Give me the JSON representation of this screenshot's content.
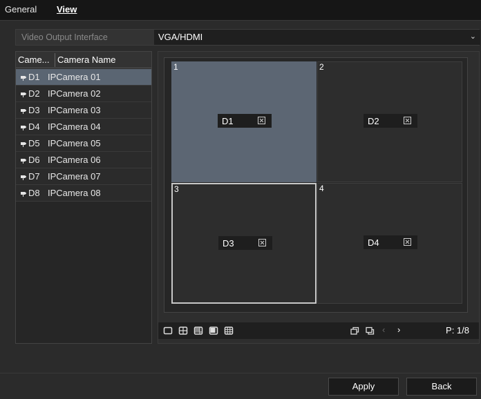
{
  "tabs": [
    {
      "label": "General",
      "active": false
    },
    {
      "label": "View",
      "active": true
    }
  ],
  "video_output": {
    "label": "Video Output Interface",
    "value": "VGA/HDMI"
  },
  "camera_list": {
    "headers": [
      "Came...",
      "Camera Name"
    ],
    "rows": [
      {
        "no": "D1",
        "name": "IPCamera 01",
        "selected": true
      },
      {
        "no": "D2",
        "name": "IPCamera 02",
        "selected": false
      },
      {
        "no": "D3",
        "name": "IPCamera 03",
        "selected": false
      },
      {
        "no": "D4",
        "name": "IPCamera 04",
        "selected": false
      },
      {
        "no": "D5",
        "name": "IPCamera 05",
        "selected": false
      },
      {
        "no": "D6",
        "name": "IPCamera 06",
        "selected": false
      },
      {
        "no": "D7",
        "name": "IPCamera 07",
        "selected": false
      },
      {
        "no": "D8",
        "name": "IPCamera 08",
        "selected": false
      }
    ]
  },
  "windows": [
    {
      "no": "1",
      "camera": "D1",
      "selected": true,
      "outlined": false
    },
    {
      "no": "2",
      "camera": "D2",
      "selected": false,
      "outlined": false
    },
    {
      "no": "3",
      "camera": "D3",
      "selected": false,
      "outlined": true
    },
    {
      "no": "4",
      "camera": "D4",
      "selected": false,
      "outlined": false
    }
  ],
  "toolbar": {
    "layout_icons": [
      "single-layout-icon",
      "quad-layout-icon",
      "six-layout-icon",
      "eight-layout-icon",
      "nine-layout-icon"
    ],
    "page": "P: 1/8"
  },
  "buttons": {
    "apply": "Apply",
    "back": "Back"
  },
  "colors": {
    "selected": "#5c6673",
    "background": "#2b2b2b"
  }
}
